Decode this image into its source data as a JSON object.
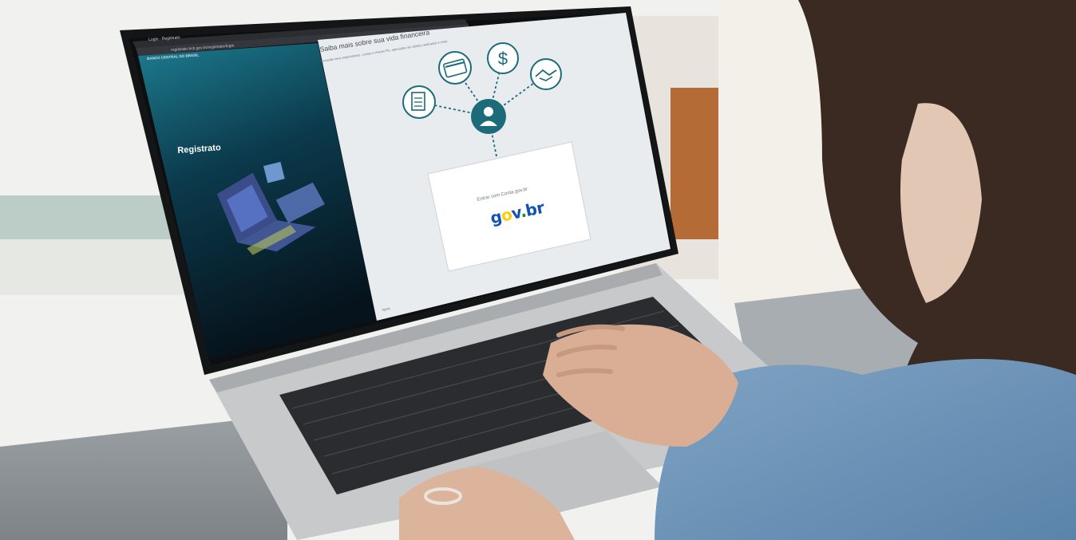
{
  "browser": {
    "tab_title": "Login - Registrato",
    "url": "registrato.bcb.gov.br/registrato/login"
  },
  "sidebar": {
    "bank_name": "BANCO CENTRAL DO BRASIL",
    "title": "Registrato"
  },
  "main": {
    "heading": "Saiba mais sobre sua vida financeira",
    "subheading": "Consulte seus empréstimos, contas e chaves Pix, operações de câmbio realizadas e mais.",
    "login_prompt": "Entrar com Conta gov.br",
    "gov_logo": {
      "g": "g",
      "o": "o",
      "v": "v",
      "dot": ".",
      "b": "b",
      "r": "r"
    },
    "footer_link": "Ajuda"
  },
  "icons": [
    "document-icon",
    "credit-card-icon",
    "dollar-icon",
    "handshake-icon",
    "user-icon"
  ],
  "colors": {
    "accent": "#1b6b7a",
    "sidebar_top": "#1e7c90",
    "sidebar_bottom": "#06131c",
    "gov_blue": "#1351b4",
    "gov_yellow": "#ffcd07",
    "gov_green": "#168821"
  }
}
